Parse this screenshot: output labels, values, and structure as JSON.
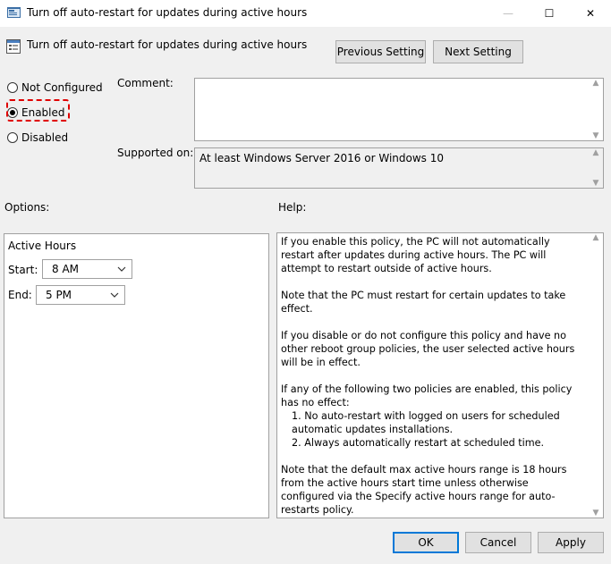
{
  "window": {
    "title": "Turn off auto-restart for updates during active hours",
    "minimize": "—",
    "maximize": "☐",
    "close": "✕"
  },
  "header": {
    "policy_title": "Turn off auto-restart for updates during active hours",
    "previous_label": "Previous Setting",
    "next_label": "Next Setting"
  },
  "state": {
    "options": [
      {
        "label": "Not Configured",
        "checked": false
      },
      {
        "label": "Enabled",
        "checked": true
      },
      {
        "label": "Disabled",
        "checked": false
      }
    ]
  },
  "comment": {
    "label": "Comment:",
    "value": ""
  },
  "supported": {
    "label": "Supported on:",
    "value": "At least Windows Server 2016 or Windows 10"
  },
  "options_section": {
    "label": "Options:",
    "group_title": "Active Hours",
    "start_label": "Start:",
    "start_value": "8 AM",
    "end_label": "End:",
    "end_value": "5 PM"
  },
  "help": {
    "label": "Help:",
    "p1": "If you enable this policy, the PC will not automatically restart after updates during active hours. The PC will attempt to restart outside of active hours.",
    "p2": "Note that the PC must restart for certain updates to take effect.",
    "p3": "If you disable or do not configure this policy and have no other reboot group policies, the user selected active hours will be in effect.",
    "p4": "If any of the following two policies are enabled, this policy has no effect:",
    "p4_item1": "1. No auto-restart with logged on users for scheduled automatic updates installations.",
    "p4_item2": "2. Always automatically restart at scheduled time.",
    "p5": "Note that the default max active hours range is 18 hours from the active hours start time unless otherwise configured via the Specify active hours range for auto-restarts policy."
  },
  "footer": {
    "ok_label": "OK",
    "cancel_label": "Cancel",
    "apply_label": "Apply"
  },
  "colors": {
    "highlight": "#e00000",
    "accent": "#0078d7"
  }
}
